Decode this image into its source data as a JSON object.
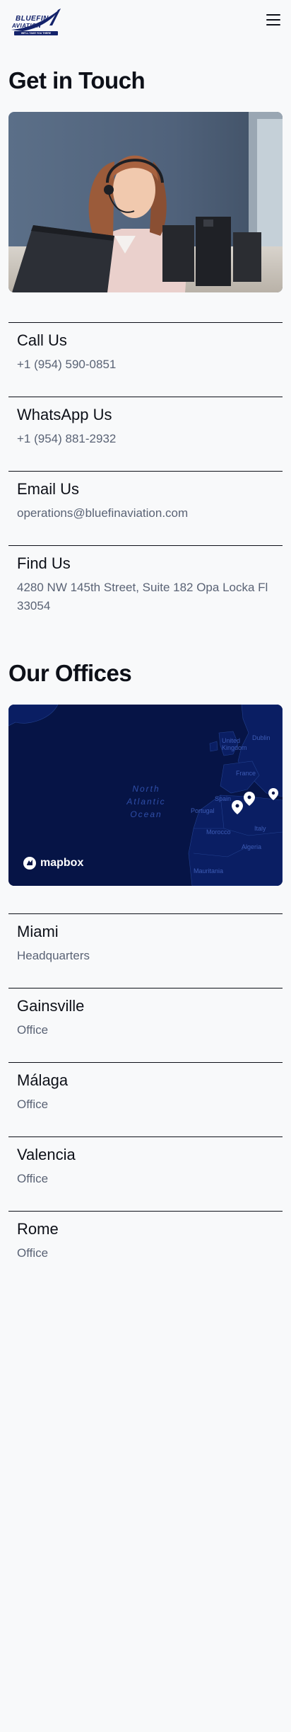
{
  "header": {
    "logo": {
      "line1": "BLUEFIN",
      "line2": "AVIATION",
      "tagline": "WE'LL TAKE YOU THERE"
    },
    "menu_icon": "hamburger-icon"
  },
  "contact": {
    "title": "Get in Touch",
    "items": [
      {
        "label": "Call Us",
        "value": "+1 (954) 590-0851"
      },
      {
        "label": "WhatsApp Us",
        "value": "+1 (954) 881-2932"
      },
      {
        "label": "Email Us",
        "value": "operations@bluefinaviation.com"
      },
      {
        "label": "Find Us",
        "value": "4280 NW 145th Street, Suite 182 Opa Locka Fl 33054"
      }
    ]
  },
  "offices": {
    "title": "Our Offices",
    "map": {
      "ocean_label": "North Atlantic Ocean",
      "places": [
        "United Kingdom",
        "Dublin",
        "France",
        "Spain",
        "Italy",
        "Morocco",
        "Algeria",
        "Mauritania",
        "Portugal"
      ],
      "attribution": "mapbox",
      "colors": {
        "land": "#0a1e63",
        "water": "#061446",
        "border": "#22418f"
      }
    },
    "items": [
      {
        "name": "Miami",
        "type": "Headquarters"
      },
      {
        "name": "Gainsville",
        "type": "Office"
      },
      {
        "name": "Málaga",
        "type": "Office"
      },
      {
        "name": "Valencia",
        "type": "Office"
      },
      {
        "name": "Rome",
        "type": "Office"
      }
    ]
  },
  "colors": {
    "background": "#f8f9fa",
    "text": "#0d1018",
    "muted_text": "#5a6375",
    "brand": "#14236b"
  }
}
